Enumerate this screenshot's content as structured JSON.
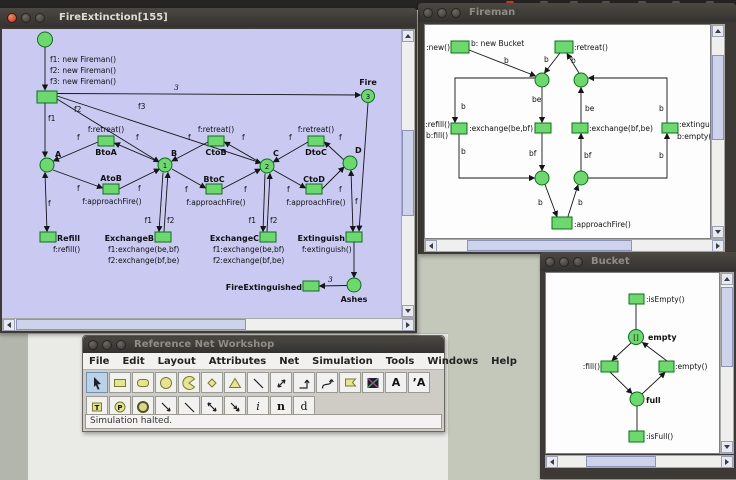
{
  "fire": {
    "title": "FireExtinction[155]",
    "net": {
      "mk1": "f1: new Fireman()",
      "mk2": "f2: new Fireman()",
      "mk3": "f3: new Fireman()",
      "w3": "3",
      "f": "f",
      "f1": "f1",
      "f2": "f2",
      "f3": "f3",
      "fire": "Fire",
      "a": "A",
      "b": "B",
      "c": "C",
      "d": "D",
      "t1": "1",
      "t2": "2",
      "t3": "3",
      "retreat": "f:retreat()",
      "approach": "f:approachFire()",
      "btoa": "BtoA",
      "atob": "AtoB",
      "ctob": "CtoB",
      "btoc": "BtoC",
      "dtoc": "DtoC",
      "ctod": "CtoD",
      "refill": "Refill",
      "refilli": "f:refill()",
      "exb": "ExchangeB",
      "exc": "ExchangeC",
      "ex1": "f1:exchange(be,bf)",
      "ex2": "f2:exchange(bf,be)",
      "exting": "Extinguish",
      "extingi": "f:extinguish()",
      "fext": "FireExtinguished",
      "ashes": "Ashes"
    }
  },
  "fireman": {
    "title": "Fireman",
    "net": {
      "new": ":new()",
      "newb": "b: new Bucket",
      "retreat": ":retreat()",
      "refill": ":refill()",
      "bfill": "b:fill()",
      "ex1": ":exchange(be,bf)",
      "ex2": ":exchange(bf,be)",
      "exting": ":extinguish()",
      "bempty": "b:empty()",
      "approach": ":approachFire()",
      "b": "b",
      "be": "be",
      "bf": "bf"
    }
  },
  "bucket": {
    "title": "Bucket",
    "net": {
      "isEmpty": ":isEmpty()",
      "empty": "empty",
      "fill": ":fill()",
      "emptyT": ":empty()",
      "full": "full",
      "isFull": ":isFull()",
      "marking": "[]"
    }
  },
  "workshop": {
    "title": "Reference Net Workshop",
    "menus": [
      "File",
      "Edit",
      "Layout",
      "Attributes",
      "Net",
      "Simulation",
      "Tools",
      "Windows",
      "Help"
    ],
    "letters": {
      "A": "A",
      "A2": "ʼA",
      "T": "T",
      "P": "P",
      "i": "i",
      "n": "n",
      "d": "d"
    },
    "status": "Simulation halted."
  }
}
